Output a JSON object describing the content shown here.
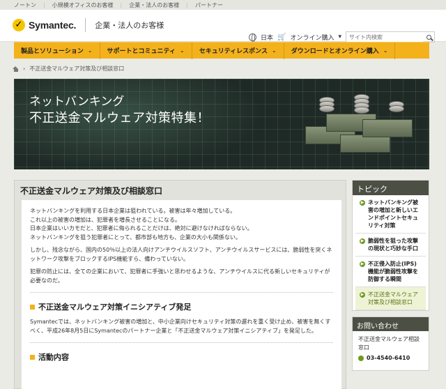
{
  "topbar": {
    "links": [
      "ノートン",
      "小規模オフィスのお客様",
      "企業・法人のお客様",
      "パートナー"
    ]
  },
  "header": {
    "brand": "Symantec.",
    "section": "企業・法人のお客様",
    "locale": "日本",
    "shop": "オンライン購入",
    "search_placeholder": "サイト内検索"
  },
  "nav": {
    "items": [
      "製品とソリューション",
      "サポートとコミュニティ",
      "セキュリティレスポンス",
      "ダウンロードとオンライン購入"
    ]
  },
  "breadcrumb": {
    "current": "不正送金マルウェア対策及び相談窓口"
  },
  "hero": {
    "line1": "ネットバンキング",
    "line2": "不正送金マルウェア対策特集！"
  },
  "main": {
    "title": "不正送金マルウェア対策及び相談窓口",
    "paragraphs": [
      "ネットバンキングを利用する日本企業は狙われている。被害は年々増加している。\nこれ以上の被害の増加は、犯罪者を増長させることになる。\n日本企業はいいカモだと、犯罪者に侮られることだけは、絶対に避けなければならない。\nネットバンキングを狙う犯罪者にとって、都市部も地方も、企業の大小も関係ない。",
      "しかし、残念ながら、国内の50％以上の法人向けアンチウイルスソフト、アンチウイルスサービスには、脆弱性を突くネットワーク攻撃をブロックするIPS機能すら、備わっていない。",
      "犯罪の防止には、全ての企業において、犯罪者に手強いと思わせるような、アンチウイルスに代る新しいセキュリティが必要なのだ。"
    ],
    "section1": {
      "heading": "不正送金マルウェア対策イニシアティブ発足",
      "text": "Symantecでは、ネットバンキング被害の増加と、中小企業向けセキュリティ対策の遅れを重く受け止め、被害を無くすべく、平成26年8月5日にSymantecのパートナー企業と「不正送金マルウェア対策イニシアティブ」を発足した。"
    },
    "section2": {
      "heading": "活動内容"
    }
  },
  "sidebar": {
    "topics_title": "トピック",
    "topics": [
      "ネットバンキング被害の増加と新しいエンドポイントセキュリティ対策",
      "脆弱性を狙った攻撃の現状と巧妙な手口",
      "不正侵入防止(IPS)機能が脆弱性攻撃を防御する瞬間",
      "不正送金マルウェア対策及び相談窓口"
    ],
    "contact_title": "お問い合わせ",
    "contact_text": "不正送金マルウェア相談窓口",
    "contact_phone": "03-4540-6410"
  },
  "colors": {
    "nav": "#f3b11c",
    "sidebar_head": "#4b4f44",
    "accent_green": "#6e9a1e"
  }
}
